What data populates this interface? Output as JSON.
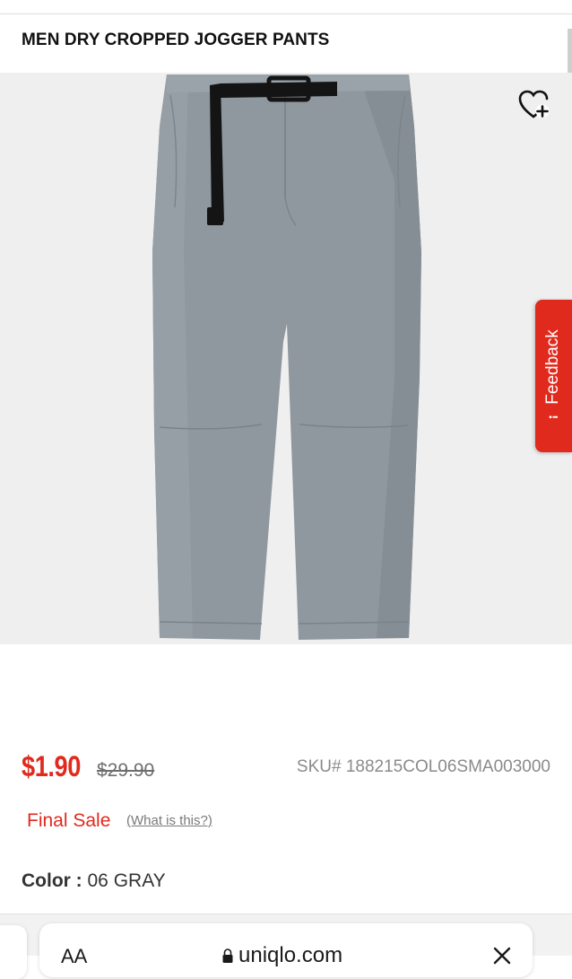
{
  "header": {
    "product_title": "MEN DRY CROPPED JOGGER PANTS"
  },
  "icons": {
    "wishlist": "heart-plus-icon",
    "feedback": "feedback-icon",
    "lock": "lock-icon",
    "close": "close-icon"
  },
  "feedback": {
    "label": "Feedback"
  },
  "pricing": {
    "sale_price": "$1.90",
    "original_price": "$29.90",
    "sku": "SKU# 188215COL06SMA003000"
  },
  "sale_info": {
    "final_sale": "Final Sale",
    "what_link": "(What is this?)"
  },
  "color": {
    "label": "Color :",
    "value": "06 GRAY"
  },
  "browser": {
    "text_size_button": "AA",
    "url": "uniqlo.com"
  },
  "colors": {
    "accent_red": "#e02a1d",
    "pant_gray": "#8c959c",
    "belt_black": "#141414"
  }
}
